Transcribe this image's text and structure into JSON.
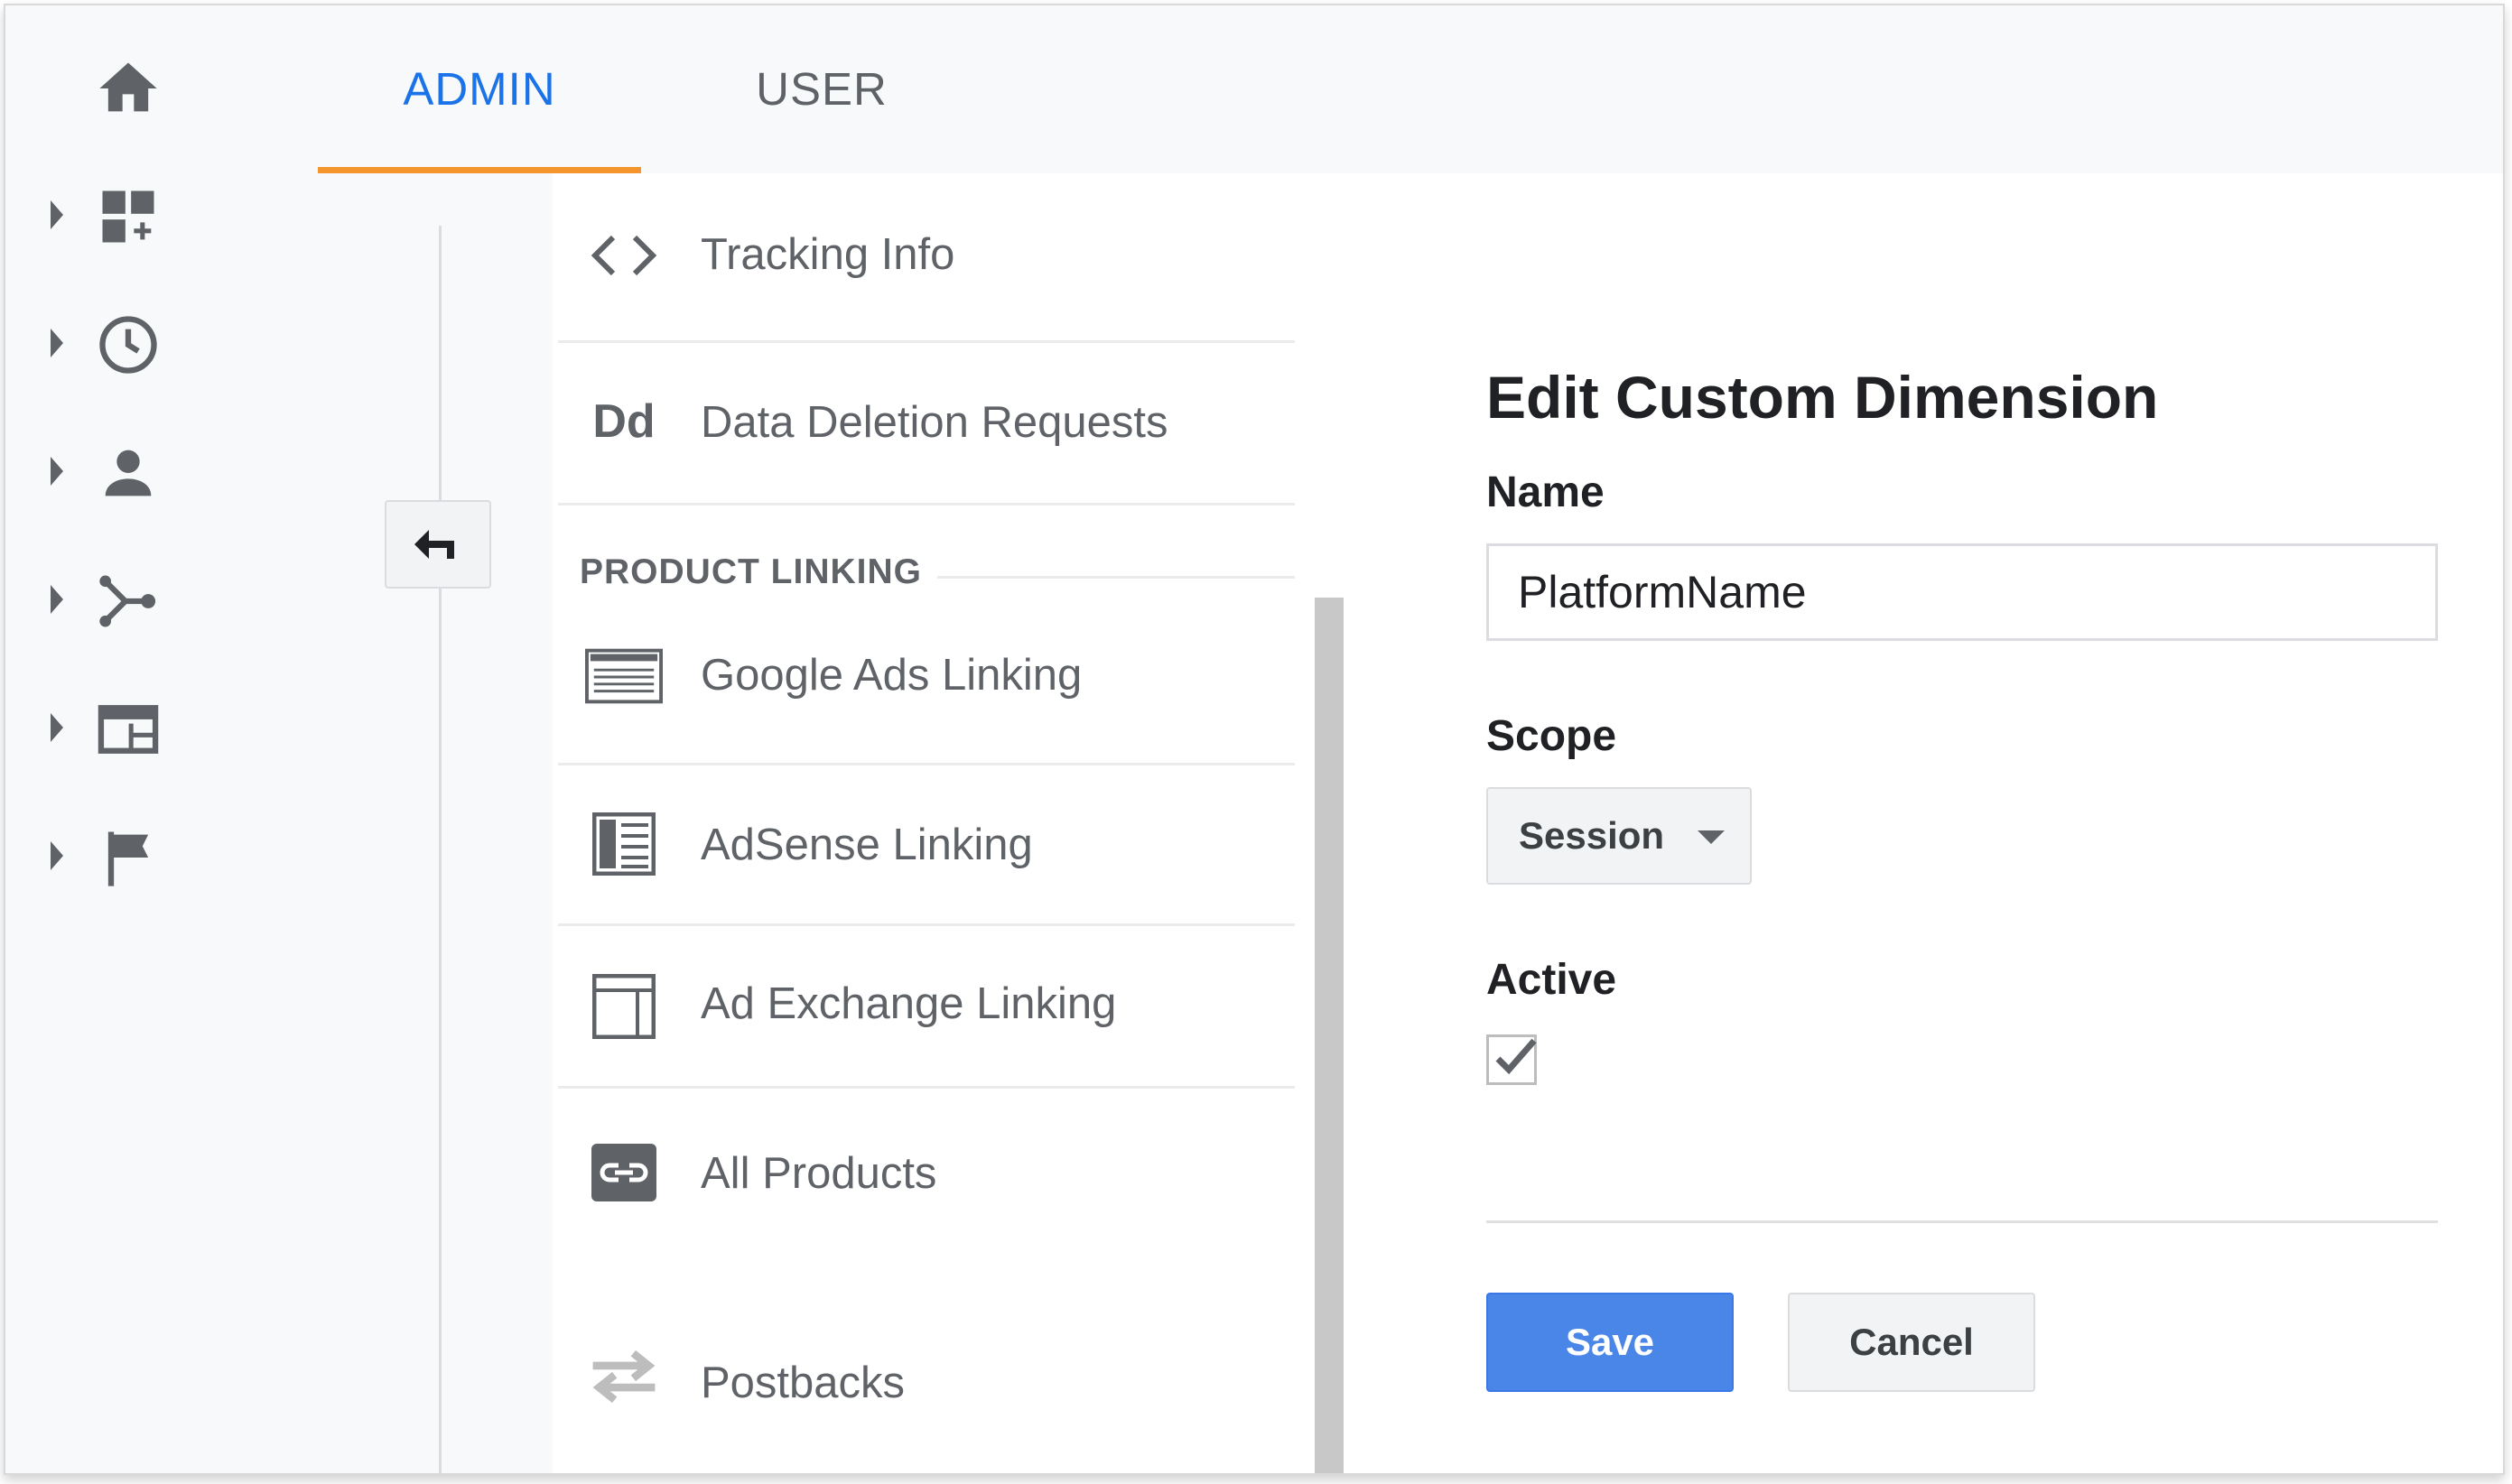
{
  "tabs": [
    {
      "label": "ADMIN",
      "active": true
    },
    {
      "label": "USER",
      "active": false
    }
  ],
  "rail": {
    "items": [
      {
        "icon": "home-icon"
      },
      {
        "icon": "customization-icon"
      },
      {
        "icon": "realtime-clock-icon"
      },
      {
        "icon": "audience-person-icon"
      },
      {
        "icon": "acquisition-icon"
      },
      {
        "icon": "behavior-icon"
      },
      {
        "icon": "conversions-flag-icon"
      }
    ]
  },
  "menu": {
    "items": [
      {
        "label": "Tracking Info",
        "icon": "code-brackets-icon"
      },
      {
        "label": "Data Deletion Requests",
        "icon": "dd-icon",
        "icon_text": "Dd"
      },
      {
        "label": "Google Ads Linking",
        "icon": "google-ads-icon"
      },
      {
        "label": "AdSense Linking",
        "icon": "adsense-icon"
      },
      {
        "label": "Ad Exchange Linking",
        "icon": "ad-exchange-icon"
      },
      {
        "label": "All Products",
        "icon": "link-icon"
      },
      {
        "label": "Postbacks",
        "icon": "postbacks-icon"
      }
    ],
    "section_heading": "PRODUCT LINKING"
  },
  "form": {
    "title": "Edit Custom Dimension",
    "name_label": "Name",
    "name_value": "PlatformName",
    "scope_label": "Scope",
    "scope_value": "Session",
    "active_label": "Active",
    "active_checked": true,
    "save_label": "Save",
    "cancel_label": "Cancel"
  },
  "colors": {
    "accent_blue": "#1a73e8",
    "tab_underline": "#f4952e",
    "save_button": "#4a86e8"
  }
}
